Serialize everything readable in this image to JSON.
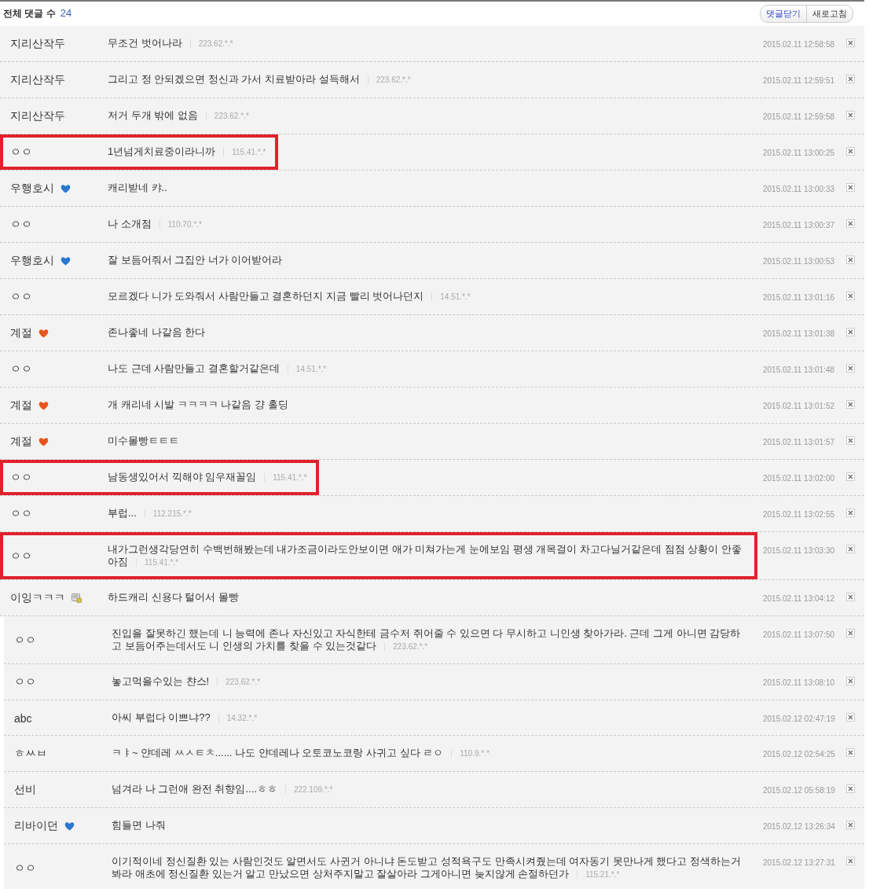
{
  "header": {
    "label": "전체 댓글 수",
    "count": "24",
    "buttons": [
      {
        "label": "댓글닫기",
        "kind": "primary"
      },
      {
        "label": "새로고침",
        "kind": "normal"
      }
    ]
  },
  "comments": [
    {
      "name": "지리산작두",
      "text": "무조건 벗어나라",
      "ip": "223.62.*.*",
      "date": "2015.02.11 12:58:58",
      "highlighted": false
    },
    {
      "name": "지리산작두",
      "text": "그리고 정 안되겠으면 정신과 가서 치료받아라 설득해서",
      "ip": "223.62.*.*",
      "date": "2015.02.11 12:59:51",
      "highlighted": false
    },
    {
      "name": "지리산작두",
      "text": "저거 두개 밖에 없음",
      "ip": "223.62.*.*",
      "date": "2015.02.11 12:59:58",
      "highlighted": false
    },
    {
      "name": "ㅇㅇ",
      "text": "1년넘게치료중이라니까",
      "ip": "115.41.*.*",
      "date": "2015.02.11 13:00:25",
      "highlighted": true
    },
    {
      "name": "우행호시",
      "badge": {
        "kind": "heart",
        "color": "#2878d0"
      },
      "text": "캐리받네 캬..",
      "date": "2015.02.11 13:00:33",
      "highlighted": false
    },
    {
      "name": "ㅇㅇ",
      "text": "나 소개점",
      "ip": "110.70.*.*",
      "date": "2015.02.11 13:00:37",
      "highlighted": false
    },
    {
      "name": "우행호시",
      "badge": {
        "kind": "heart",
        "color": "#2878d0"
      },
      "text": "잘 보듬어줘서 그집안 너가 이어받어라",
      "date": "2015.02.11 13:00:53",
      "highlighted": false
    },
    {
      "name": "ㅇㅇ",
      "text": "모르겠다 니가 도와줘서 사람만들고 결혼하던지 지금 빨리 벗어나던지",
      "ip": "14.51.*.*",
      "date": "2015.02.11 13:01:16",
      "highlighted": false
    },
    {
      "name": "계절",
      "badge": {
        "kind": "heart",
        "color": "#e8541c"
      },
      "text": "존나좋네 나같음 한다",
      "date": "2015.02.11 13:01:38",
      "highlighted": false
    },
    {
      "name": "ㅇㅇ",
      "text": "나도 근데 사람만들고 결혼할거같은데",
      "ip": "14.51.*.*",
      "date": "2015.02.11 13:01:48",
      "highlighted": false
    },
    {
      "name": "계절",
      "badge": {
        "kind": "heart",
        "color": "#e8541c"
      },
      "text": "개 캐리네 시발 ㅋㅋㅋㅋ 나같음 걍 홀딩",
      "date": "2015.02.11 13:01:52",
      "highlighted": false
    },
    {
      "name": "계절",
      "badge": {
        "kind": "heart",
        "color": "#e8541c"
      },
      "text": "미수몰빵ㅌㅌㅌ",
      "date": "2015.02.11 13:01:57",
      "highlighted": false
    },
    {
      "name": "ㅇㅇ",
      "text": "남동생있어서 끽해야 임우재꼴임",
      "ip": "115.41.*.*",
      "date": "2015.02.11 13:02:00",
      "highlighted": true
    },
    {
      "name": "ㅇㅇ",
      "text": "부럽...",
      "ip": "112.215.*.*",
      "date": "2015.02.11 13:02:55",
      "highlighted": false
    },
    {
      "name": "ㅇㅇ",
      "text": "내가그런생각당연히 수백번해봤는데 내가조금이라도안보이면 애가 미쳐가는게 눈에보임 평생 개목걸이 차고다닐거같은데 점점 상황이 안좋아짐",
      "ip": "115.41.*.*",
      "date": "2015.02.11 13:03:30",
      "highlighted": true
    },
    {
      "name": "이잉ㅋㅋㅋ",
      "badge": {
        "kind": "note"
      },
      "text": "하드캐리 신용다 털어서 몰빵",
      "date": "2015.02.11 13:04:12",
      "highlighted": false
    }
  ],
  "later_comments": [
    {
      "name": "ㅇㅇ",
      "text": "진입을 잘못하긴 했는데 니 능력에 존나 자신있고 자식한테 금수저 쥐어줄 수 있으면 다 무시하고 니인생 찾아가라. 근데 그게 아니면 감당하고 보듬어주는데서도 니 인생의 가치를 찾을 수 있는것같다",
      "ip": "223.62.*.*",
      "date": "2015.02.11 13:07:50",
      "highlighted": false
    },
    {
      "name": "ㅇㅇ",
      "text": "놓고먹을수있는 챤스!",
      "ip": "223.62.*.*",
      "date": "2015.02.11 13:08:10",
      "highlighted": false
    },
    {
      "name": "abc",
      "text": "아씨 부럽다 이쁘냐??",
      "ip": "14.32.*.*",
      "date": "2015.02.12 02:47:19",
      "highlighted": false
    },
    {
      "name": "ㅎㅆㅂ",
      "text": "ㅋㅑ~ 얀데레 ㅆㅅㅌㅊ...... 나도 얀데레나 오토코노코랑 사귀고 싶다 ㄹㅇ",
      "ip": "110.9.*.*",
      "date": "2015.02.12 02:54:25",
      "highlighted": false
    },
    {
      "name": "선비",
      "text": "넘겨라 나 그런애 완전 취향임....ㅎㅎ",
      "ip": "222.109.*.*",
      "date": "2015.02.12 05:58:19",
      "highlighted": false
    },
    {
      "name": "리바이던",
      "badge": {
        "kind": "heart",
        "color": "#2878d0"
      },
      "text": "힘들면 나줘",
      "date": "2015.02.12 13:26:34",
      "highlighted": false
    },
    {
      "name": "ㅇㅇ",
      "text": "이기적이네 정신질환 있는 사람인것도 알면서도 사귄거 아니냐 돈도받고 성적욕구도 만족시켜줬는데 여자동기 못만나게 했다고 정색하는거봐라 애초에 정신질환 있는거 알고 만났으면 상처주지말고 잘살아라 그게아니면 늦지않게 손절하던가",
      "ip": "115.21.*.*",
      "date": "2015.02.12 13:27:31",
      "highlighted": false
    }
  ]
}
